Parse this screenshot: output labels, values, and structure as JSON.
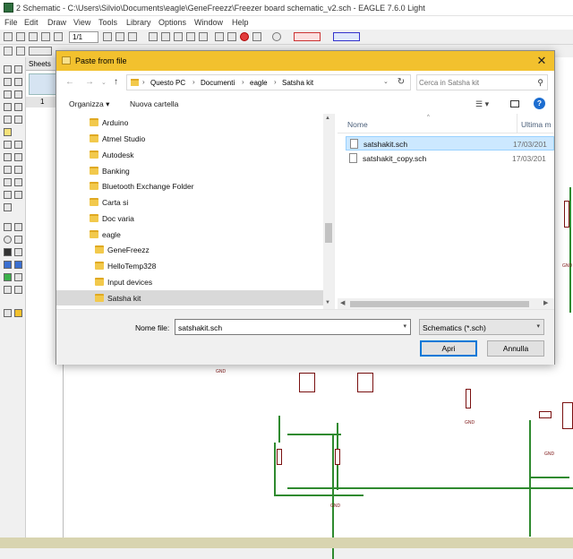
{
  "window": {
    "title": "2 Schematic - C:\\Users\\Silvio\\Documents\\eagle\\GeneFreezz\\Freezer board schematic_v2.sch - EAGLE 7.6.0 Light"
  },
  "menu": [
    "File",
    "Edit",
    "Draw",
    "View",
    "Tools",
    "Library",
    "Options",
    "Window",
    "Help"
  ],
  "toolbar": {
    "grid_value": "1/1"
  },
  "sheets": {
    "header": "Sheets",
    "row_number": "1"
  },
  "dialog": {
    "title": "Paste from file",
    "address": [
      "Questo PC",
      "Documenti",
      "eagle",
      "Satsha kit"
    ],
    "search_placeholder": "Cerca in Satsha kit",
    "organize_label": "Organizza",
    "new_folder_label": "Nuova cartella",
    "tree": [
      {
        "label": "Arduino",
        "level": 0,
        "selected": false
      },
      {
        "label": "Atmel Studio",
        "level": 0,
        "selected": false
      },
      {
        "label": "Autodesk",
        "level": 0,
        "selected": false
      },
      {
        "label": "Banking",
        "level": 0,
        "selected": false
      },
      {
        "label": "Bluetooth Exchange Folder",
        "level": 0,
        "selected": false
      },
      {
        "label": "Carta si",
        "level": 0,
        "selected": false
      },
      {
        "label": "Doc varia",
        "level": 0,
        "selected": false
      },
      {
        "label": "eagle",
        "level": 0,
        "selected": false
      },
      {
        "label": "GeneFreezz",
        "level": 1,
        "selected": false
      },
      {
        "label": "HelloTemp328",
        "level": 1,
        "selected": false
      },
      {
        "label": "Input devices",
        "level": 1,
        "selected": false
      },
      {
        "label": "Satsha kit",
        "level": 1,
        "selected": true
      }
    ],
    "columns": {
      "name": "Nome",
      "date": "Ultima m"
    },
    "files": [
      {
        "name": "satshakit.sch",
        "date": "17/03/201",
        "selected": true
      },
      {
        "name": "satshakit_copy.sch",
        "date": "17/03/201",
        "selected": false
      }
    ],
    "filename_label": "Nome file:",
    "filename_value": "satshakit.sch",
    "filter_value": "Schematics (*.sch)",
    "open_label": "Apri",
    "cancel_label": "Annulla"
  }
}
